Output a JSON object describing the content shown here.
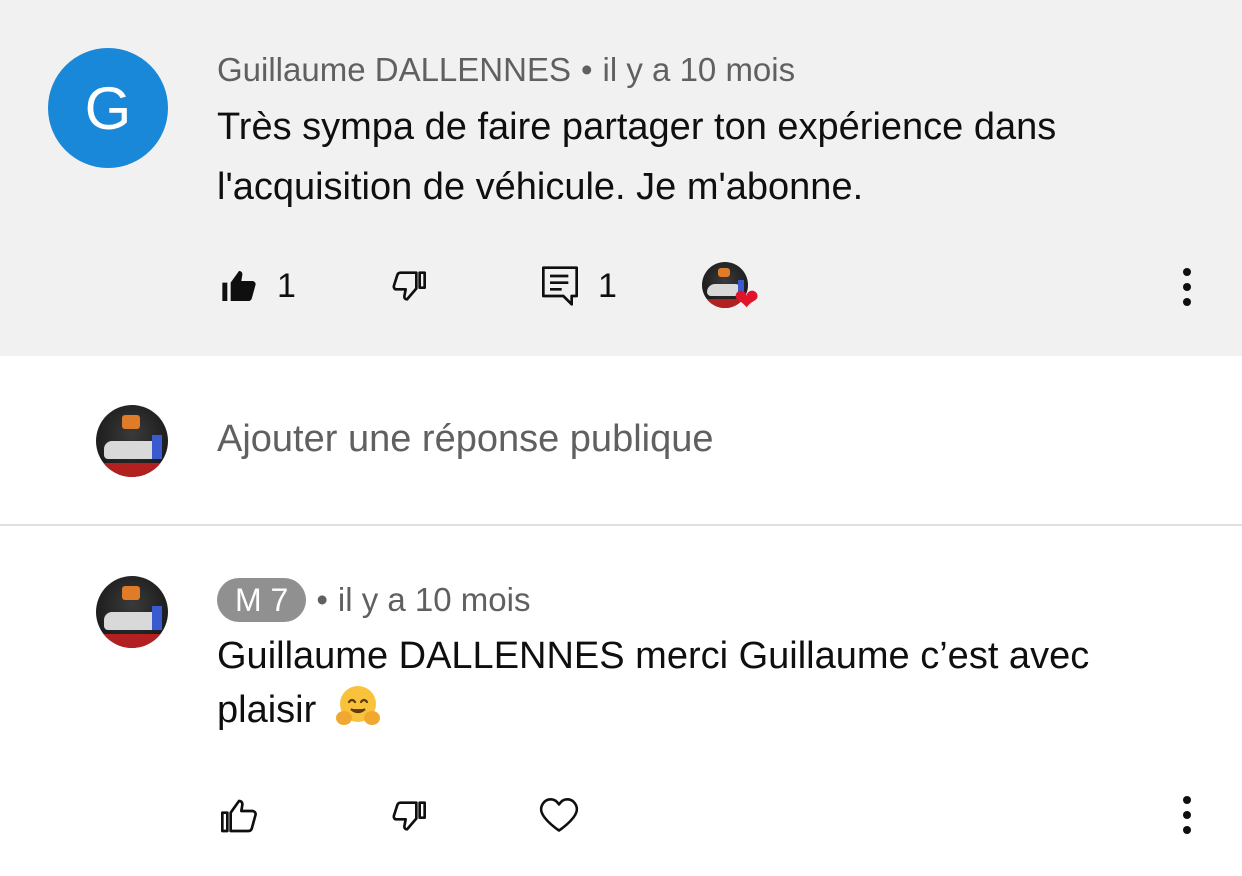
{
  "top_comment": {
    "avatar_letter": "G",
    "author": "Guillaume DALLENNES",
    "separator": "•",
    "time": "il y a 10 mois",
    "text_line1": "Très sympa de faire partager ton expérience dans",
    "text_line2": "l'acquisition de véhicule. Je m'abonne.",
    "like_count": "1",
    "reply_count": "1",
    "avatar_color": "#1a88d9",
    "background": "#f1f1f1"
  },
  "reply_box": {
    "placeholder": "Ajouter une réponse publique"
  },
  "reply": {
    "author": "M 7",
    "separator": "•",
    "time": "il y a 10 mois",
    "text_line1": "Guillaume DALLENNES merci Guillaume c’est avec",
    "text_line2": "plaisir",
    "emoji": "hugging-face-emoji"
  },
  "icons": {
    "like_filled": "thumbs-up-filled-icon",
    "dislike": "thumbs-down-icon",
    "reply": "comment-icon",
    "creator_heart": "heart-icon",
    "more": "more-vertical-icon",
    "like": "thumbs-up-icon",
    "heart_outline": "heart-outline-icon"
  }
}
